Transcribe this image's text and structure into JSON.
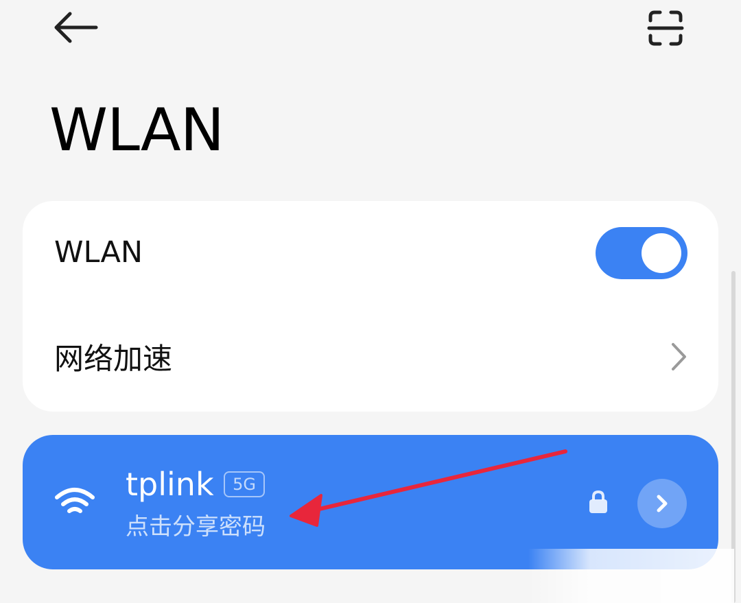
{
  "header": {
    "back_icon": "arrow-left-icon",
    "scan_icon": "scan-qr-icon",
    "title": "WLAN"
  },
  "settings": {
    "wlan_label": "WLAN",
    "wlan_enabled": true,
    "accelerate_label": "网络加速"
  },
  "network": {
    "ssid": "tplink",
    "band_badge": "5G",
    "hint": "点击分享密码",
    "secured": true,
    "wifi_icon": "wifi-icon",
    "lock_icon": "lock-icon",
    "detail_icon": "chevron-right-icon"
  },
  "colors": {
    "accent": "#3b82f3",
    "background": "#f5f5f5",
    "card": "#ffffff",
    "annotation": "#e8263b"
  }
}
